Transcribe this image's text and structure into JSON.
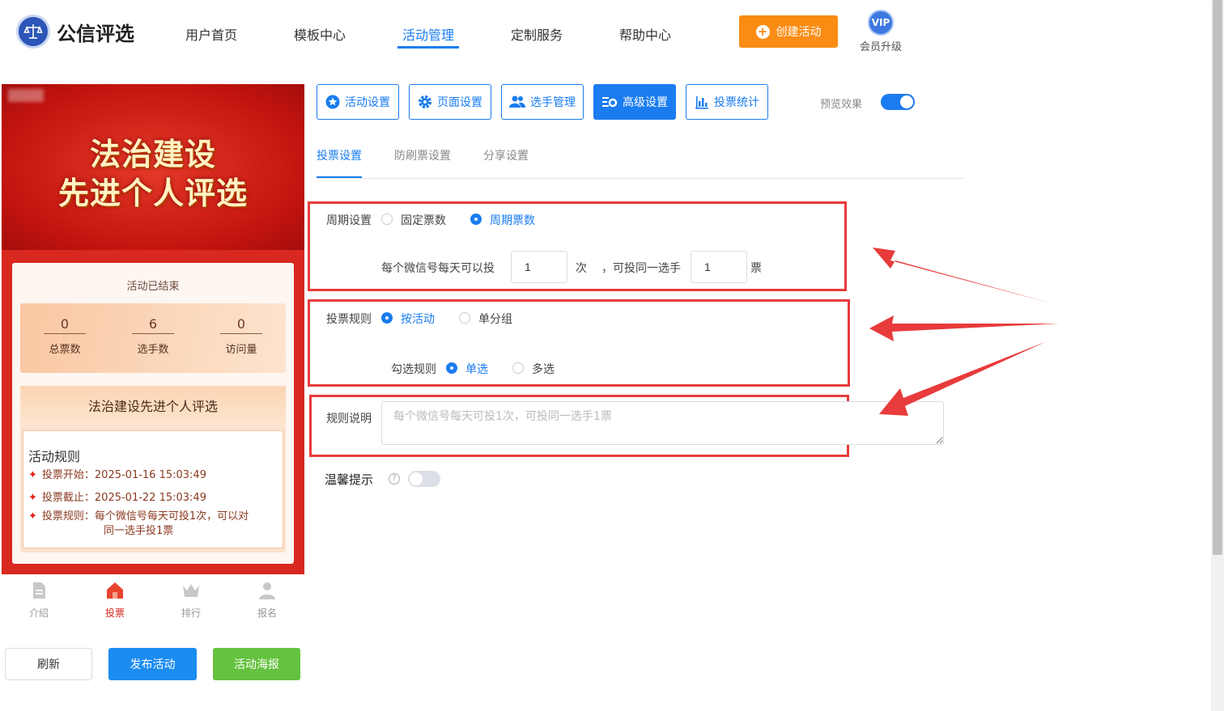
{
  "header": {
    "logo_text": "公信评选",
    "nav": [
      "用户首页",
      "模板中心",
      "活动管理",
      "定制服务",
      "帮助中心"
    ],
    "active_nav": "活动管理",
    "create_label": "创建活动",
    "vip_badge": "VIP",
    "vip_label": "会员升级"
  },
  "preview": {
    "banner_line1": "法治建设",
    "banner_line2": "先进个人评选",
    "status": "活动已结束",
    "stats": [
      {
        "value": "0",
        "label": "总票数"
      },
      {
        "value": "6",
        "label": "选手数"
      },
      {
        "value": "0",
        "label": "访问量"
      }
    ],
    "rule_card_title": "法治建设先进个人评选",
    "rules_heading": "活动规则",
    "rules": [
      "投票开始：2025-01-16 15:03:49",
      "投票截止：2025-01-22 15:03:49",
      "投票规则：每个微信号每天可投1次，可以对",
      "同一选手投1票"
    ],
    "tabs": [
      "介绍",
      "投票",
      "排行",
      "报名"
    ],
    "active_tab": "投票"
  },
  "actions": {
    "refresh": "刷新",
    "publish": "发布活动",
    "poster": "活动海报"
  },
  "toolbar": {
    "buttons": [
      "活动设置",
      "页面设置",
      "选手管理",
      "高级设置",
      "投票统计"
    ],
    "active": "高级设置",
    "preview_label": "预览效果",
    "preview_on": true
  },
  "subtabs": [
    "投票设置",
    "防刷票设置",
    "分享设置"
  ],
  "active_subtab": "投票设置",
  "form": {
    "period_label": "周期设置",
    "period_options": [
      "固定票数",
      "周期票数"
    ],
    "period_selected": "周期票数",
    "per_day_prefix": "每个微信号每天可以投",
    "times_value": "1",
    "times_unit": "次",
    "same_player_text": "，可投同一选手",
    "votes_value": "1",
    "votes_unit": "票",
    "rule_label": "投票规则",
    "rule_options": [
      "按活动",
      "单分组"
    ],
    "rule_selected": "按活动",
    "check_label": "勾选规则",
    "check_options": [
      "单选",
      "多选"
    ],
    "check_selected": "单选",
    "desc_label": "规则说明",
    "desc_placeholder": "每个微信号每天可投1次，可投同一选手1票",
    "tip_label": "温馨提示",
    "tip_on": false
  },
  "colors": {
    "primary": "#1a7cf0",
    "orange": "#fb8c13",
    "green": "#64c23e",
    "annotation_red": "#e83b3b",
    "banner_red": "#d8281f"
  }
}
